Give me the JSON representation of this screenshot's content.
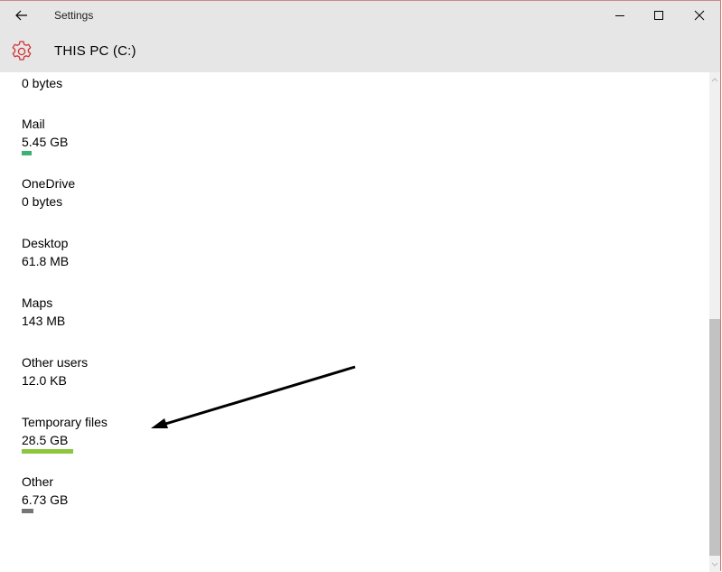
{
  "window": {
    "title": "Settings",
    "back_icon": "back-arrow-icon",
    "controls": {
      "minimize": "minimize-icon",
      "maximize": "maximize-icon",
      "close": "close-icon"
    }
  },
  "header": {
    "icon": "gear-icon",
    "title": "THIS PC (C:)",
    "accent_color": "#d13438"
  },
  "storage_items": [
    {
      "name": "",
      "size": "0 bytes"
    },
    {
      "name": "Mail",
      "size": "5.45 GB",
      "bar_color": "#3bb273"
    },
    {
      "name": "OneDrive",
      "size": "0 bytes"
    },
    {
      "name": "Desktop",
      "size": "61.8 MB"
    },
    {
      "name": "Maps",
      "size": "143 MB"
    },
    {
      "name": "Other users",
      "size": "12.0 KB"
    },
    {
      "name": "Temporary files",
      "size": "28.5 GB",
      "bar_color": "#8cc63f"
    },
    {
      "name": "Other",
      "size": "6.73 GB",
      "bar_color": "#767676"
    }
  ],
  "annotation": {
    "type": "arrow",
    "points_to": "Temporary files",
    "color": "#000000"
  }
}
